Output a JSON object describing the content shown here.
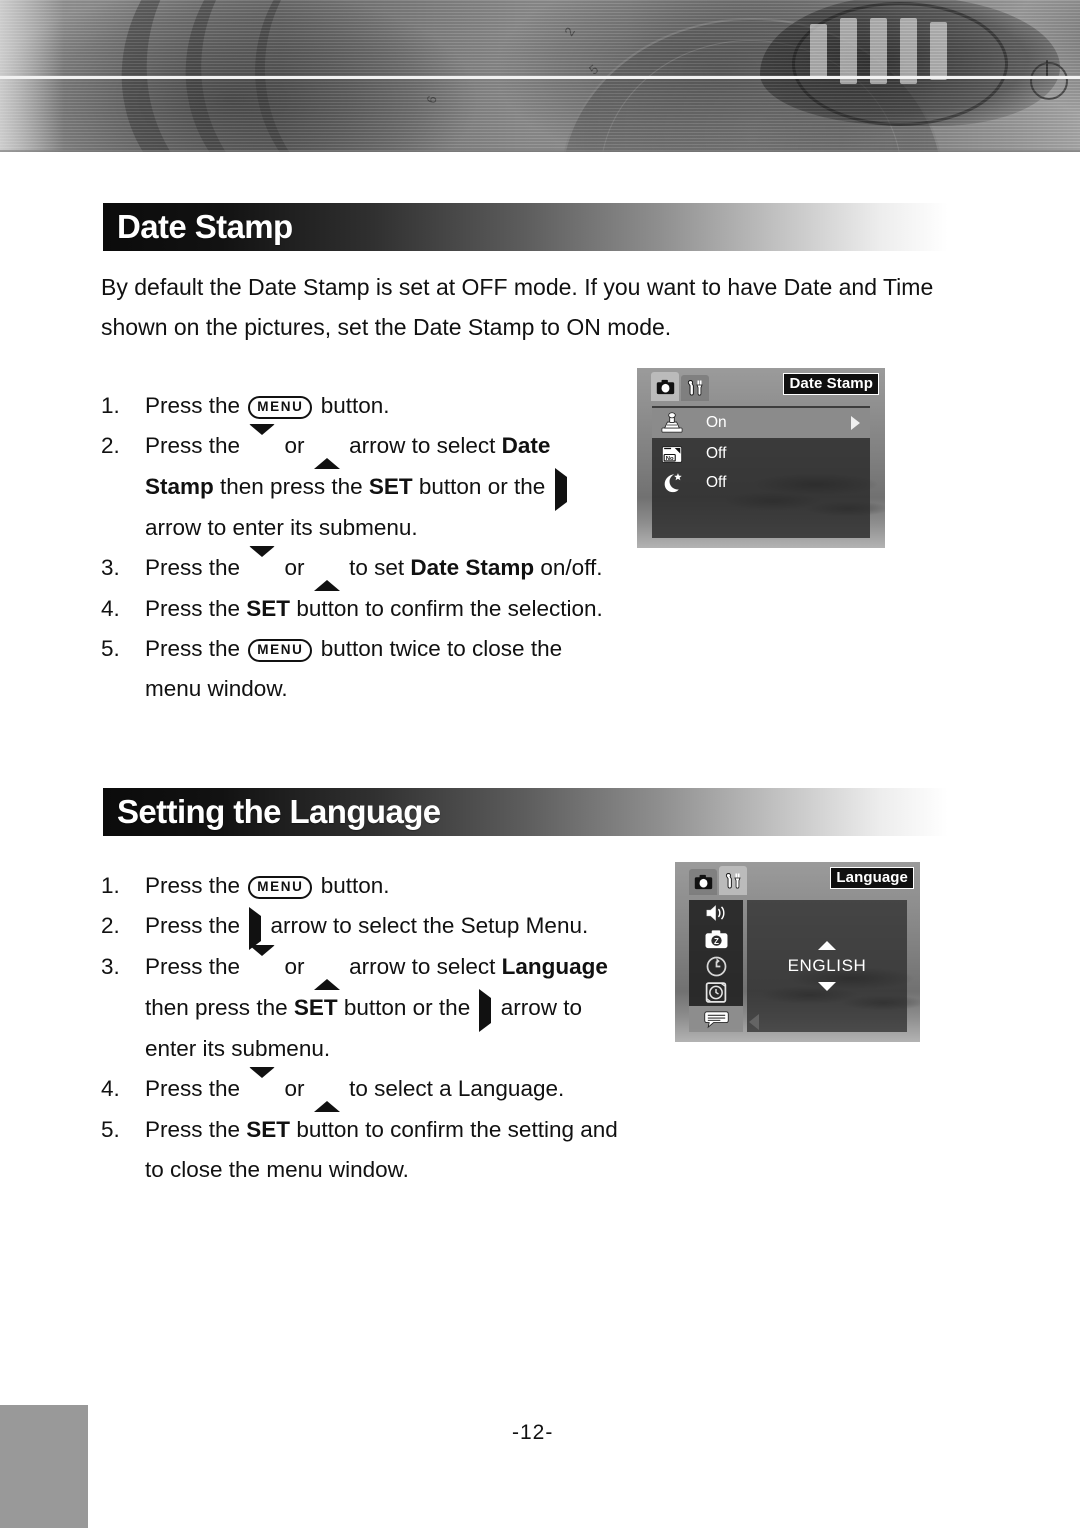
{
  "header": {
    "banner_alt": "camera-photo-banner",
    "power_icon": "power-icon",
    "engraved_marks": [
      "2",
      "5",
      "6"
    ]
  },
  "sections": [
    {
      "id": "date-stamp",
      "heading": "Date Stamp",
      "intro": "By default the Date Stamp is set at OFF mode. If you want to have Date and Time shown on the pictures, set the Date Stamp to ON mode.",
      "steps": [
        {
          "num": "1.",
          "parts": [
            {
              "t": "text",
              "v": "Press the "
            },
            {
              "t": "menu-key",
              "v": "MENU"
            },
            {
              "t": "text",
              "v": " button."
            }
          ]
        },
        {
          "num": "2.",
          "parts": [
            {
              "t": "text",
              "v": "Press the "
            },
            {
              "t": "arrow-down",
              "v": ""
            },
            {
              "t": "text",
              "v": " or "
            },
            {
              "t": "arrow-up",
              "v": ""
            },
            {
              "t": "text",
              "v": " arrow to select "
            },
            {
              "t": "bold",
              "v": "Date Stamp"
            },
            {
              "t": "text",
              "v": " then press the "
            },
            {
              "t": "bold",
              "v": "SET"
            },
            {
              "t": "text",
              "v": " button or the "
            },
            {
              "t": "arrow-right",
              "v": ""
            },
            {
              "t": "text",
              "v": " arrow to enter its submenu."
            }
          ]
        },
        {
          "num": "3.",
          "parts": [
            {
              "t": "text",
              "v": "Press the "
            },
            {
              "t": "arrow-down",
              "v": ""
            },
            {
              "t": "text",
              "v": " or "
            },
            {
              "t": "arrow-up",
              "v": ""
            },
            {
              "t": "text",
              "v": " to set "
            },
            {
              "t": "bold",
              "v": "Date Stamp"
            },
            {
              "t": "text",
              "v": " on/off."
            }
          ]
        },
        {
          "num": "4.",
          "parts": [
            {
              "t": "text",
              "v": "Press the "
            },
            {
              "t": "bold",
              "v": "SET"
            },
            {
              "t": "text",
              "v": " button to confirm the selection."
            }
          ]
        },
        {
          "num": "5.",
          "parts": [
            {
              "t": "text",
              "v": "Press the "
            },
            {
              "t": "menu-key",
              "v": "MENU"
            },
            {
              "t": "text",
              "v": " button twice to close the menu window."
            }
          ]
        }
      ]
    },
    {
      "id": "setting-the-language",
      "heading": "Setting the Language",
      "steps": [
        {
          "num": "1.",
          "parts": [
            {
              "t": "text",
              "v": "Press the "
            },
            {
              "t": "menu-key",
              "v": "MENU"
            },
            {
              "t": "text",
              "v": " button."
            }
          ]
        },
        {
          "num": "2.",
          "parts": [
            {
              "t": "text",
              "v": "Press the "
            },
            {
              "t": "arrow-right",
              "v": ""
            },
            {
              "t": "text",
              "v": " arrow to select the Setup Menu."
            }
          ]
        },
        {
          "num": "3.",
          "parts": [
            {
              "t": "text",
              "v": "Press the "
            },
            {
              "t": "arrow-down",
              "v": ""
            },
            {
              "t": "text",
              "v": " or "
            },
            {
              "t": "arrow-up",
              "v": ""
            },
            {
              "t": "text",
              "v": " arrow to select "
            },
            {
              "t": "bold",
              "v": "Language"
            },
            {
              "t": "text",
              "v": " then press the "
            },
            {
              "t": "bold",
              "v": "SET"
            },
            {
              "t": "text",
              "v": " button or the "
            },
            {
              "t": "arrow-right",
              "v": ""
            },
            {
              "t": "text",
              "v": " arrow to enter its submenu."
            }
          ]
        },
        {
          "num": "4.",
          "parts": [
            {
              "t": "text",
              "v": "Press the "
            },
            {
              "t": "arrow-down",
              "v": ""
            },
            {
              "t": "text",
              "v": " or "
            },
            {
              "t": "arrow-up",
              "v": ""
            },
            {
              "t": "text",
              "v": " to select a Language."
            }
          ]
        },
        {
          "num": "5.",
          "parts": [
            {
              "t": "text",
              "v": "Press the "
            },
            {
              "t": "bold",
              "v": "SET"
            },
            {
              "t": "text",
              "v": " button to confirm the setting and to close the menu window."
            }
          ]
        }
      ]
    }
  ],
  "lcd_date_stamp": {
    "title": "Date Stamp",
    "tabs": [
      {
        "icon": "camera-icon",
        "active": true
      },
      {
        "icon": "setup-wrench-icon",
        "active": false
      }
    ],
    "rows": [
      {
        "icon": "date-stamp-icon",
        "label": "On",
        "selected": true,
        "has_arrow": true
      },
      {
        "icon": "quick-view-no-icon",
        "label": "Off",
        "selected": false,
        "has_arrow": false
      },
      {
        "icon": "night-mode-moon-icon",
        "label": "Off",
        "selected": false,
        "has_arrow": false
      }
    ]
  },
  "lcd_language": {
    "title": "Language",
    "tabs": [
      {
        "icon": "camera-icon",
        "active": false
      },
      {
        "icon": "setup-wrench-icon",
        "active": true
      }
    ],
    "sidebar": [
      {
        "icon": "volume-speaker-icon",
        "selected": false
      },
      {
        "icon": "quick-view-camera-z-icon",
        "selected": false
      },
      {
        "icon": "reset-circular-arrow-icon",
        "selected": false
      },
      {
        "icon": "auto-power-off-icon",
        "selected": false
      },
      {
        "icon": "language-speech-icon",
        "selected": true
      }
    ],
    "value": "ENGLISH",
    "up_arrow": "scroll-up-icon",
    "down_arrow": "scroll-down-icon",
    "back_arrow": "back-left-icon"
  },
  "footer": {
    "page_number": "-12-"
  }
}
